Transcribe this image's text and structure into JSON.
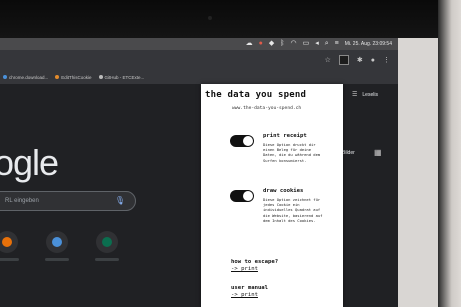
{
  "menubar": {
    "clock": "Mi. 25. Aug. 23:09:54",
    "icons": [
      "cloud-icon",
      "app-red-icon",
      "dropbox-icon",
      "bluetooth-icon",
      "wifi-icon",
      "battery-icon",
      "volume-icon",
      "spotlight-icon",
      "control-icon"
    ]
  },
  "bookmarks": [
    {
      "label": "chrome.download..."
    },
    {
      "label": "EditThisCookie"
    },
    {
      "label": "GitHub - ETCExte..."
    }
  ],
  "google": {
    "logo_text": "ogle",
    "search_placeholder": "RL eingeben",
    "right_top_label": "Leselis",
    "images_label": "Bilder"
  },
  "popup": {
    "title": "the data you spend",
    "url": "www.the-data-you-spend.ch",
    "options": [
      {
        "title": "print receipt",
        "enabled": true,
        "description": "Diese Option druckt dir einen Beleg für deine Daten, die du während dem Surfen konsumierst."
      },
      {
        "title": "draw cookies",
        "enabled": true,
        "description": "Diese Option zeichnet für jedes Cookie ein individuelles Quadrat auf die Website, basierend auf dem Inhalt des Cookies."
      }
    ],
    "escape": {
      "title": "how to escape?",
      "link": "-> print"
    },
    "manual": {
      "title": "user manual",
      "link": "-> print"
    }
  },
  "colors": {
    "accent_blue": "#8ab4f8",
    "popup_bg": "#ffffff",
    "toggle_on": "#111111"
  }
}
